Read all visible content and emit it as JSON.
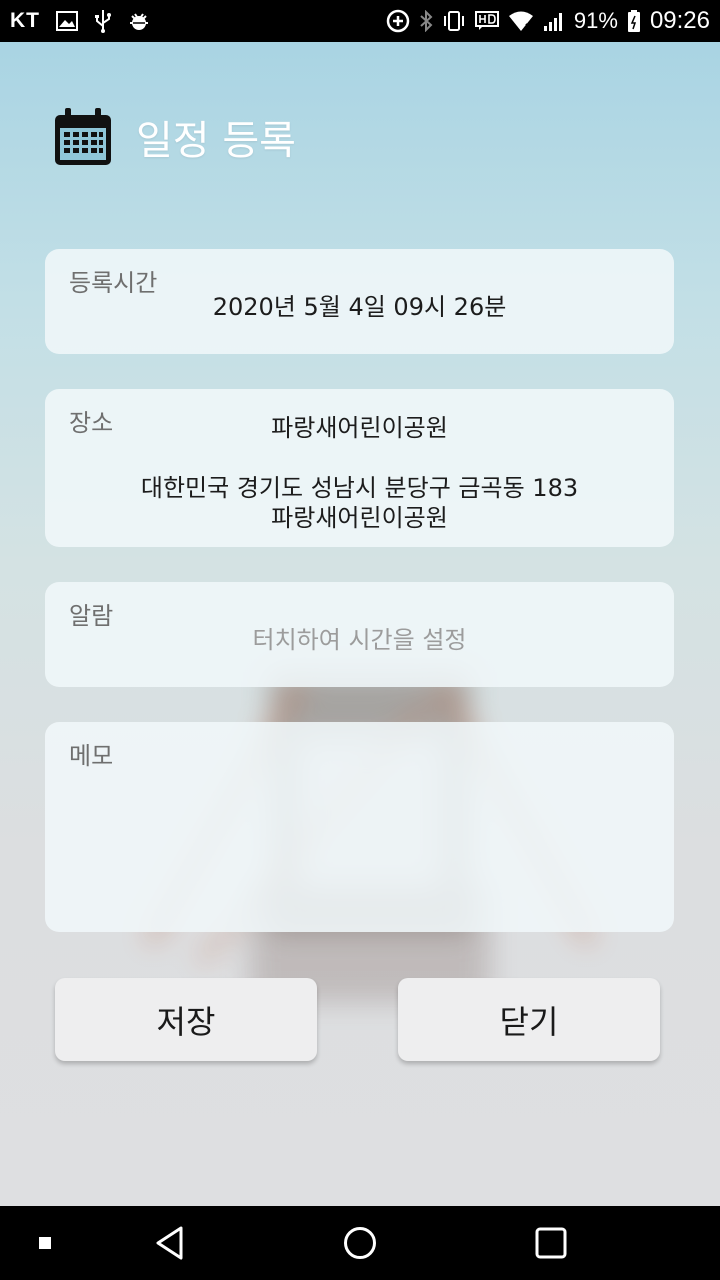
{
  "status_bar": {
    "carrier": "KT",
    "battery": "91%",
    "time": "09:26"
  },
  "header": {
    "title": "일정 등록",
    "icon": "calendar-icon"
  },
  "registration_time": {
    "label": "등록시간",
    "value": "2020년 5월 4일 09시 26분"
  },
  "location": {
    "label": "장소",
    "name": "파랑새어린이공원",
    "address_line1": "대한민국 경기도 성남시 분당구 금곡동 183",
    "address_line2": "파랑새어린이공원"
  },
  "alarm": {
    "label": "알람",
    "placeholder": "터치하여 시간을 설정"
  },
  "memo": {
    "label": "메모",
    "value": ""
  },
  "buttons": {
    "save": "저장",
    "close": "닫기"
  },
  "nav": {
    "icons": [
      "square-dot-icon",
      "back-icon",
      "home-icon",
      "recents-icon"
    ]
  }
}
